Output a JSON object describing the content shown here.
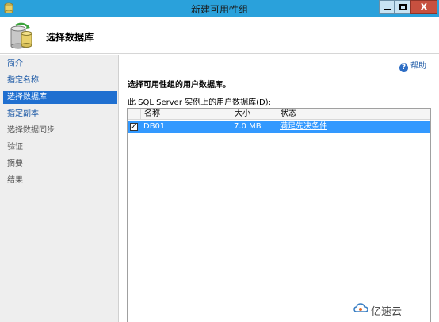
{
  "window": {
    "title": "新建可用性组",
    "close_glyph": "x"
  },
  "header": {
    "title": "选择数据库",
    "icon": "database-wizard-icon"
  },
  "sidebar": {
    "items": [
      {
        "label": "简介",
        "state": "link"
      },
      {
        "label": "指定名称",
        "state": "link"
      },
      {
        "label": "选择数据库",
        "state": "active"
      },
      {
        "label": "指定副本",
        "state": "link"
      },
      {
        "label": "选择数据同步",
        "state": "disabled"
      },
      {
        "label": "验证",
        "state": "disabled"
      },
      {
        "label": "摘要",
        "state": "disabled"
      },
      {
        "label": "结果",
        "state": "disabled"
      }
    ]
  },
  "main": {
    "help_label": "帮助",
    "instruction": "选择可用性组的用户数据库。",
    "grid_label": "此 SQL Server 实例上的用户数据库(D):",
    "columns": [
      "名称",
      "大小",
      "状态"
    ],
    "rows": [
      {
        "checked": true,
        "name": "DB01",
        "size": "7.0 MB",
        "status": "满足先决条件"
      }
    ]
  },
  "watermark": {
    "text": "亿速云"
  },
  "colors": {
    "titlebar": "#2aa1db",
    "selection": "#3399ff",
    "sidebar_active": "#1f6fd0",
    "link": "#1d5aa6"
  }
}
